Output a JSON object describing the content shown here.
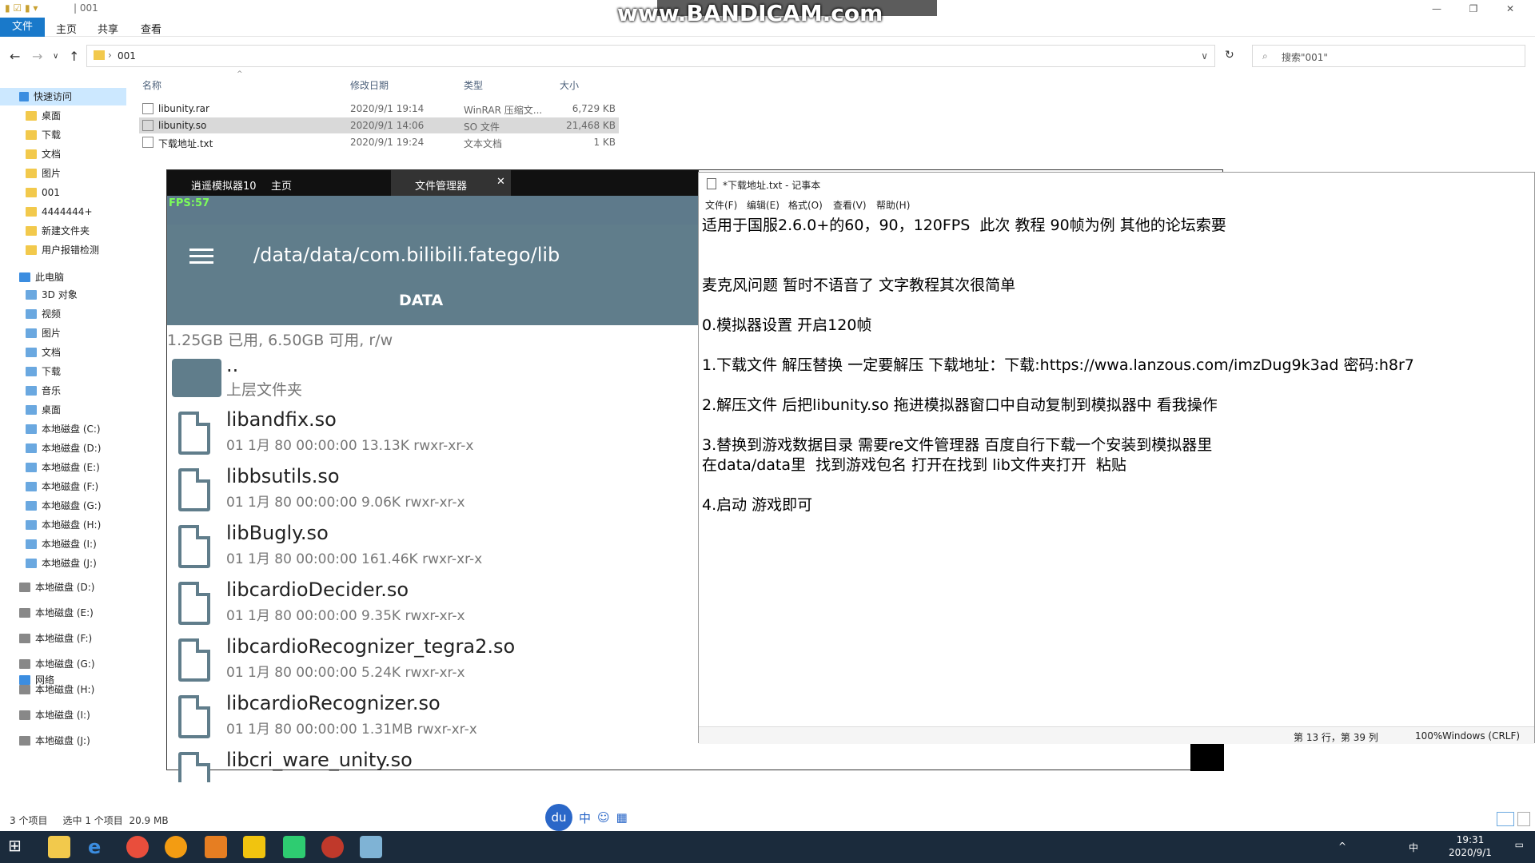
{
  "explorer": {
    "title": "| 001",
    "ribbon_tabs": [
      "文件",
      "主页",
      "共享",
      "查看"
    ],
    "address_path": "001",
    "search_placeholder": "搜索\"001\"",
    "columns": {
      "name": "名称",
      "date": "修改日期",
      "type": "类型",
      "size": "大小"
    },
    "files": [
      {
        "name": "libunity.rar",
        "date": "2020/9/1 19:14",
        "type": "WinRAR 压缩文...",
        "size": "6,729 KB"
      },
      {
        "name": "libunity.so",
        "date": "2020/9/1 14:06",
        "type": "SO 文件",
        "size": "21,468 KB"
      },
      {
        "name": "下载地址.txt",
        "date": "2020/9/1 19:24",
        "type": "文本文档",
        "size": "1 KB"
      }
    ],
    "nav": {
      "quick_access": "快速访问",
      "quick": [
        "桌面",
        "下载",
        "文档",
        "图片",
        "001",
        "4444444+",
        "新建文件夹",
        "用户报错检测"
      ],
      "this_pc": "此电脑",
      "pc": [
        "3D 对象",
        "视频",
        "图片",
        "文档",
        "下载",
        "音乐",
        "桌面",
        "本地磁盘 (C:)",
        "本地磁盘 (D:)",
        "本地磁盘 (E:)",
        "本地磁盘 (F:)",
        "本地磁盘 (G:)",
        "本地磁盘 (H:)",
        "本地磁盘 (I:)",
        "本地磁盘 (J:)"
      ],
      "drives": [
        "本地磁盘 (D:)",
        "本地磁盘 (E:)",
        "本地磁盘 (F:)",
        "本地磁盘 (G:)",
        "本地磁盘 (H:)",
        "本地磁盘 (I:)",
        "本地磁盘 (J:)"
      ],
      "network": "网络"
    },
    "status": {
      "count": "3 个项目",
      "selected": "选中 1 个项目",
      "size": "20.9 MB"
    }
  },
  "emulator": {
    "tabs": [
      "逍遥模拟器10",
      "主页",
      "文件管理器"
    ],
    "fps": "FPS:57",
    "path": "/data/data/com.bilibili.fatego/lib",
    "section": "DATA",
    "storage": "1.25GB 已用, 6.50GB 可用, r/w",
    "parent": {
      "name": "..",
      "label": "上层文件夹"
    },
    "files": [
      {
        "name": "libandfix.so",
        "meta": "01 1月 80 00:00:00  13.13K  rwxr-xr-x"
      },
      {
        "name": "libbsutils.so",
        "meta": "01 1月 80 00:00:00  9.06K  rwxr-xr-x"
      },
      {
        "name": "libBugly.so",
        "meta": "01 1月 80 00:00:00  161.46K  rwxr-xr-x"
      },
      {
        "name": "libcardioDecider.so",
        "meta": "01 1月 80 00:00:00  9.35K  rwxr-xr-x"
      },
      {
        "name": "libcardioRecognizer_tegra2.so",
        "meta": "01 1月 80 00:00:00  5.24K  rwxr-xr-x"
      },
      {
        "name": "libcardioRecognizer.so",
        "meta": "01 1月 80 00:00:00  1.31MB  rwxr-xr-x"
      },
      {
        "name": "libcri_ware_unity.so",
        "meta": ""
      }
    ]
  },
  "notepad": {
    "title": "*下载地址.txt - 记事本",
    "menu": [
      "文件(F)",
      "编辑(E)",
      "格式(O)",
      "查看(V)",
      "帮助(H)"
    ],
    "text": "适用于国服2.6.0+的60，90，120FPS  此次 教程 90帧为例 其他的论坛索要\n\n\n麦克风问题 暂时不语音了 文字教程其次很简单\n\n0.模拟器设置 开启120帧\n\n1.下载文件 解压替换 一定要解压 下载地址：下载:https://wwa.lanzous.com/imzDug9k3ad 密码:h8r7\n\n2.解压文件 后把libunity.so 拖进模拟器窗口中自动复制到模拟器中 看我操作\n\n3.替换到游戏数据目录 需要re文件管理器 百度自行下载一个安装到模拟器里\n在data/data里  找到游戏包名 打开在找到 lib文件夹打开  粘贴\n\n4.启动 游戏即可",
    "status": {
      "pos": "第 13 行，第 39 列",
      "zoom": "100%",
      "eol": "Windows (CRLF)"
    }
  },
  "overlay": {
    "bandicam": "www.BANDICAM.com"
  },
  "ime": {
    "logo": "du",
    "lang": "中"
  },
  "taskbar": {
    "time": "19:31",
    "date": "2020/9/1",
    "tray_lang": "中"
  }
}
